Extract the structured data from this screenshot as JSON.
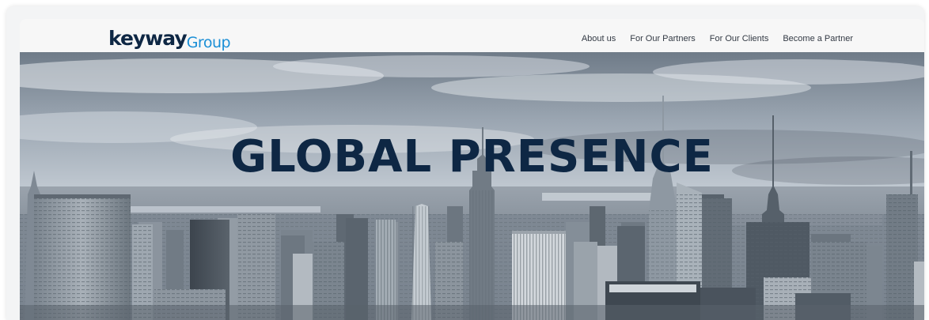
{
  "brand": {
    "logo_main": "keyway",
    "logo_sub": "Group"
  },
  "nav": {
    "items": [
      {
        "label": "About us"
      },
      {
        "label": "For Our Partners"
      },
      {
        "label": "For Our Clients"
      },
      {
        "label": "Become a Partner"
      }
    ]
  },
  "hero": {
    "title": "GLOBAL PRESENCE"
  },
  "colors": {
    "brand_navy": "#0e2744",
    "brand_blue": "#1b8fd6"
  }
}
